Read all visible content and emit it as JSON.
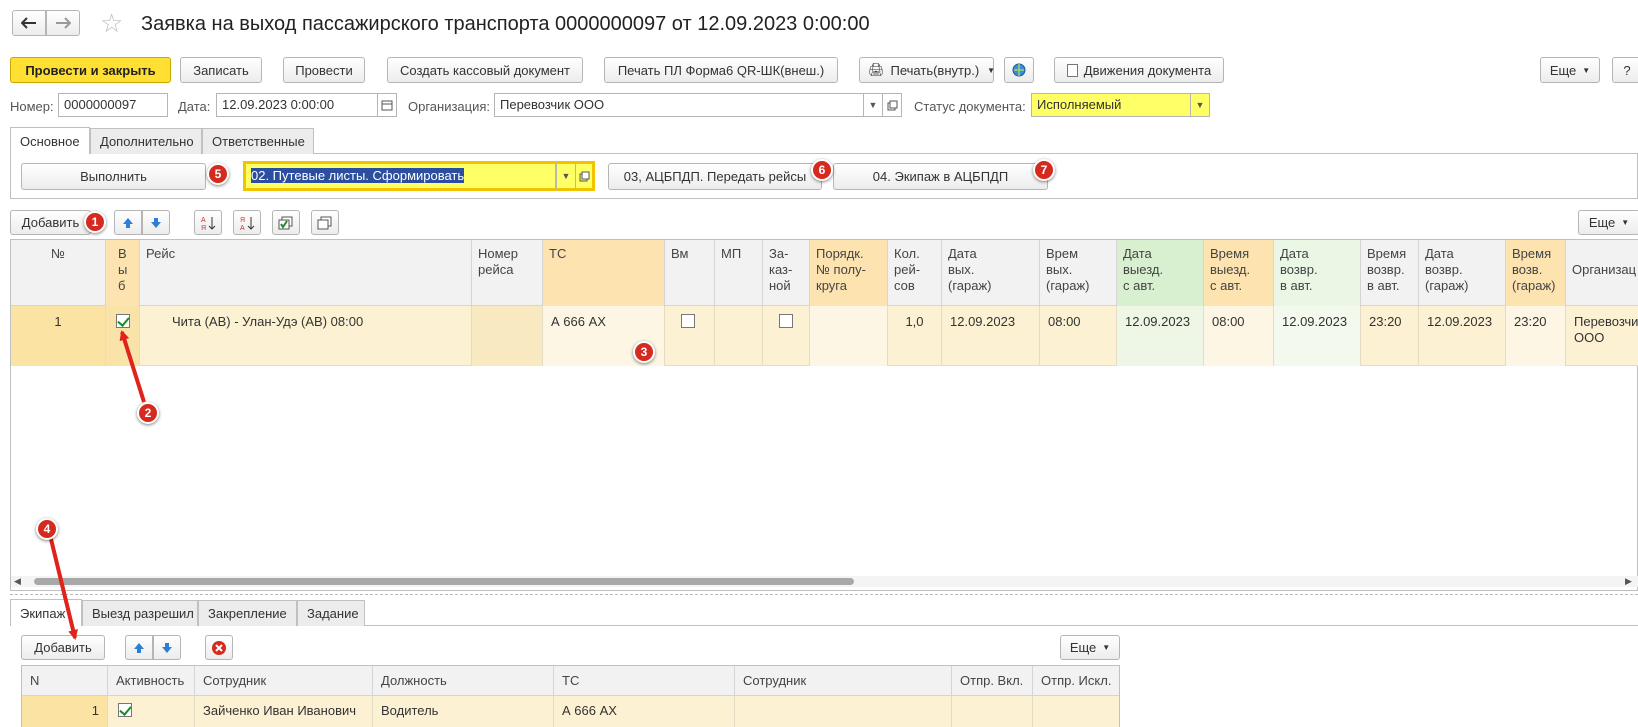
{
  "window": {
    "title": "Заявка на выход пассажирского транспорта 0000000097 от 12.09.2023 0:00:00"
  },
  "toolbar": {
    "post_close": "Провести и закрыть",
    "save": "Записать",
    "post": "Провести",
    "create_cash_doc": "Создать кассовый документ",
    "print_pl": "Печать ПЛ Форма6 QR-ШК(внеш.)",
    "print_internal": "Печать(внутр.)",
    "doc_movements": "Движения документа",
    "more": "Еще",
    "help": "?"
  },
  "header": {
    "number_label": "Номер:",
    "number_value": "0000000097",
    "date_label": "Дата:",
    "date_value": "12.09.2023  0:00:00",
    "org_label": "Организация:",
    "org_value": "Перевозчик ООО",
    "status_label": "Статус документа:",
    "status_value": "Исполняемый"
  },
  "tabs": [
    "Основное",
    "Дополнительно",
    "Ответственные"
  ],
  "actions": {
    "execute": "Выполнить",
    "step_select": "02. Путевые листы. Сформировать",
    "send_trips": "03, АЦБПДП. Передать рейсы",
    "crew": "04. Экипаж  в АЦБПДП"
  },
  "grid_toolbar": {
    "add": "Добавить",
    "more": "Еще"
  },
  "grid": {
    "columns": [
      "№",
      "В\nы\nб",
      "Рейс",
      "Номер\nрейса",
      "ТС",
      "Вм",
      "МП",
      "За-\nказ-\nной",
      "Порядк.\n№ полу-\nкруга",
      "Кол.\nрей-\nсов",
      "Дата\nвых.\n(гараж)",
      "Врем\nвых.\n(гараж)",
      "Дата\nвыезд.\nс авт.",
      "Время\nвыезд.\nс авт.",
      "Дата\nвозвр.\nв авт.",
      "Время\nвозвр.\nв авт.",
      "Дата\nвозвр.\n(гараж)",
      "Время\nвозв.\n(гараж)",
      "Организац"
    ],
    "row": {
      "num": "1",
      "route": "Чита (АВ) - Улан-Удэ (АВ) 08:00",
      "trip_number": "",
      "vehicle": "А 666 АХ",
      "trips_count": "1,0",
      "garage_out_date": "12.09.2023",
      "garage_out_time": "08:00",
      "depart_date": "12.09.2023",
      "depart_time": "08:00",
      "return_date": "12.09.2023",
      "return_time": "23:20",
      "garage_return_date": "12.09.2023",
      "garage_return_time": "23:20",
      "org": "Перевозчик\nООО"
    }
  },
  "bottom_tabs": [
    "Экипаж",
    "Выезд разрешил",
    "Закрепление",
    "Задание"
  ],
  "bottom_toolbar": {
    "add": "Добавить",
    "more": "Еще"
  },
  "crew_grid": {
    "columns": [
      "N",
      "Активность",
      "Сотрудник",
      "Должность",
      "ТС",
      "Сотрудник",
      "Отпр. Вкл.",
      "Отпр. Искл."
    ],
    "row": {
      "n": "1",
      "employee": "Зайченко Иван Иванович",
      "position": "Водитель",
      "vehicle": "А 666 АХ"
    }
  },
  "annotations": [
    "1",
    "2",
    "3",
    "4",
    "5",
    "6",
    "7"
  ],
  "colors": {
    "primary_button": "#ffe032",
    "highlight_field": "#ffff66",
    "selected_row": "#fdf1d4",
    "badge": "#d42a20"
  }
}
